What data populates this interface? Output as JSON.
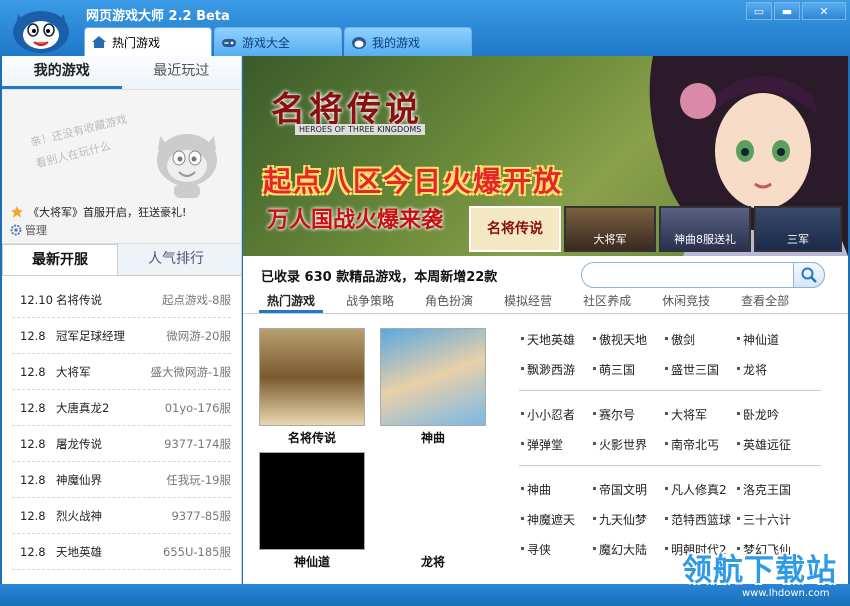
{
  "app": {
    "title": "网页游戏大师 2.2 Beta"
  },
  "window": {
    "menu_glyph": "▭",
    "min_glyph": "▬",
    "close_glyph": "✕"
  },
  "tabs": [
    {
      "label": "热门游戏",
      "active": true
    },
    {
      "label": "游戏大全",
      "active": false
    },
    {
      "label": "我的游戏",
      "active": false
    }
  ],
  "left": {
    "tabs": [
      {
        "label": "我的游戏",
        "active": true
      },
      {
        "label": "最近玩过",
        "active": false
      }
    ],
    "fav_tip_line1": "亲！还没有收藏游戏",
    "fav_tip_line2": "看别人在玩什么",
    "notice": "《大将军》首服开启，狂送豪礼!",
    "manage": "管理",
    "bottom_tabs": [
      {
        "label": "最新开服",
        "active": true
      },
      {
        "label": "人气排行",
        "active": false
      }
    ],
    "servers": [
      {
        "date": "12.10",
        "name": "名将传说",
        "server": "起点游戏-8服"
      },
      {
        "date": "12.8",
        "name": "冠军足球经理",
        "server": "微网游-20服"
      },
      {
        "date": "12.8",
        "name": "大将军",
        "server": "盛大微网游-1服"
      },
      {
        "date": "12.8",
        "name": "大唐真龙2",
        "server": "01yo-176服"
      },
      {
        "date": "12.8",
        "name": "屠龙传说",
        "server": "9377-174服"
      },
      {
        "date": "12.8",
        "name": "神魔仙界",
        "server": "任我玩-19服"
      },
      {
        "date": "12.8",
        "name": "烈火战神",
        "server": "9377-85服"
      },
      {
        "date": "12.8",
        "name": "天地英雄",
        "server": "655U-185服"
      }
    ]
  },
  "banner": {
    "logo": "名将传说",
    "logo_en": "HEROES OF THREE KINGDOMS",
    "headline": "起点八区今日火爆开放",
    "subline": "万人国战火爆来袭",
    "thumbs": [
      "名将传说",
      "大将军",
      "神曲8服送礼",
      "三军"
    ]
  },
  "main": {
    "summary": "已收录 630 款精品游戏，本周新增22款",
    "search_placeholder": "",
    "categories": [
      {
        "label": "热门游戏",
        "active": true
      },
      {
        "label": "战争策略",
        "active": false
      },
      {
        "label": "角色扮演",
        "active": false
      },
      {
        "label": "模拟经营",
        "active": false
      },
      {
        "label": "社区养成",
        "active": false
      },
      {
        "label": "休闲竞技",
        "active": false
      },
      {
        "label": "查看全部",
        "active": false
      }
    ],
    "featured": [
      "名将传说",
      "神曲",
      "神仙道",
      "龙将"
    ],
    "groups": [
      [
        [
          "天地英雄",
          "傲视天地",
          "傲剑",
          "神仙道"
        ],
        [
          "飘渺西游",
          "萌三国",
          "盛世三国",
          "龙将"
        ]
      ],
      [
        [
          "小小忍者",
          "赛尔号",
          "大将军",
          "卧龙吟"
        ],
        [
          "弹弹堂",
          "火影世界",
          "南帝北丐",
          "英雄远征"
        ]
      ],
      [
        [
          "神曲",
          "帝国文明",
          "凡人修真2",
          "洛克王国"
        ],
        [
          "神魔遮天",
          "九天仙梦",
          "范特西篮球",
          "三十六计"
        ],
        [
          "寻侠",
          "魔幻大陆",
          "明朝时代2",
          "梦幻飞仙"
        ]
      ]
    ]
  },
  "watermark": {
    "text": "领航下载站",
    "url": "www.lhdown.com"
  },
  "colors": {
    "accent": "#1f78c8",
    "titlebar": "#3b9be6"
  }
}
